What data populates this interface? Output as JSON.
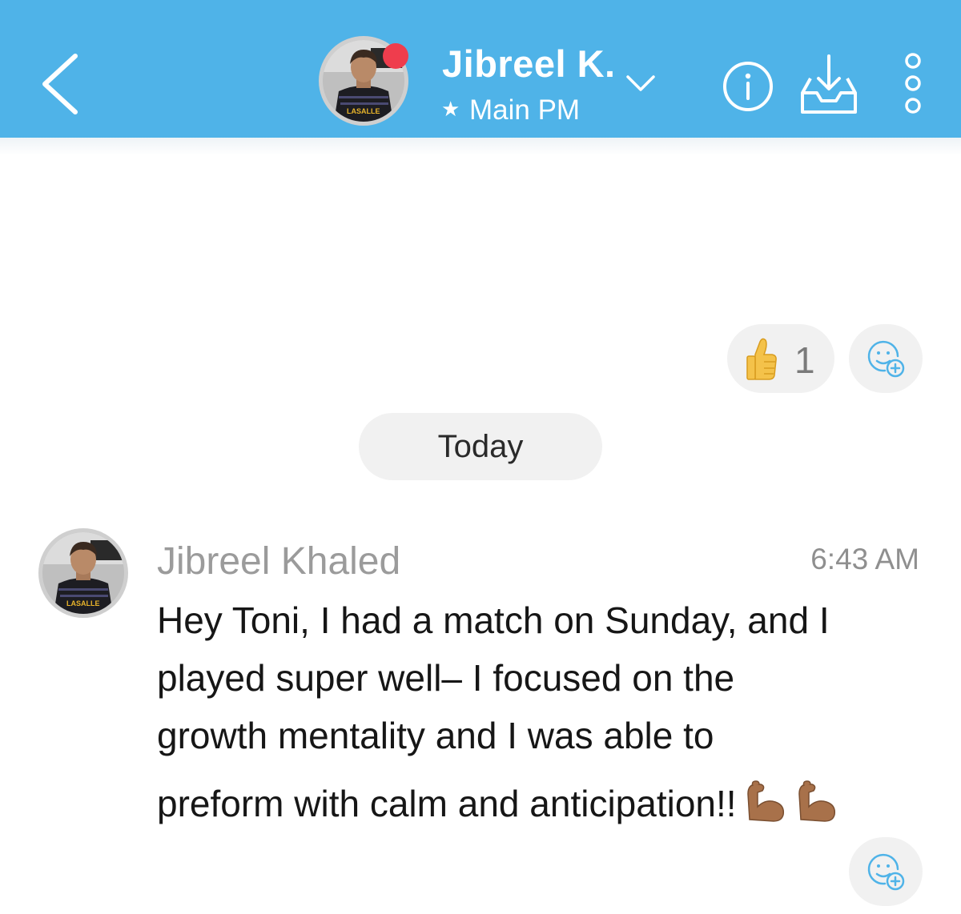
{
  "header": {
    "contact_name": "Jibreel K.",
    "subtitle": "Main PM",
    "subtitle_icon": "star-icon",
    "presence": "online",
    "colors": {
      "bar": "#4fb3e8",
      "presence_dot": "#ef3d4d"
    },
    "avatar_jersey_text": "LASALLE",
    "icons": [
      "back-arrow-icon",
      "chevron-down-icon",
      "info-icon",
      "inbox-download-icon",
      "more-vertical-icon"
    ]
  },
  "reactions": {
    "emoji": "thumbs-up",
    "count": "1",
    "add_reaction_icon": "add-reaction-icon"
  },
  "date_divider": "Today",
  "message": {
    "sender": "Jibreel Khaled",
    "time": "6:43 AM",
    "lines": [
      "Hey Toni, I had a match on Sunday, and I",
      "played super well– I focused on the",
      "growth mentality and I was able to",
      "preform with calm and anticipation!!"
    ],
    "trailing_emoji": [
      "flexed-biceps",
      "flexed-biceps"
    ]
  }
}
